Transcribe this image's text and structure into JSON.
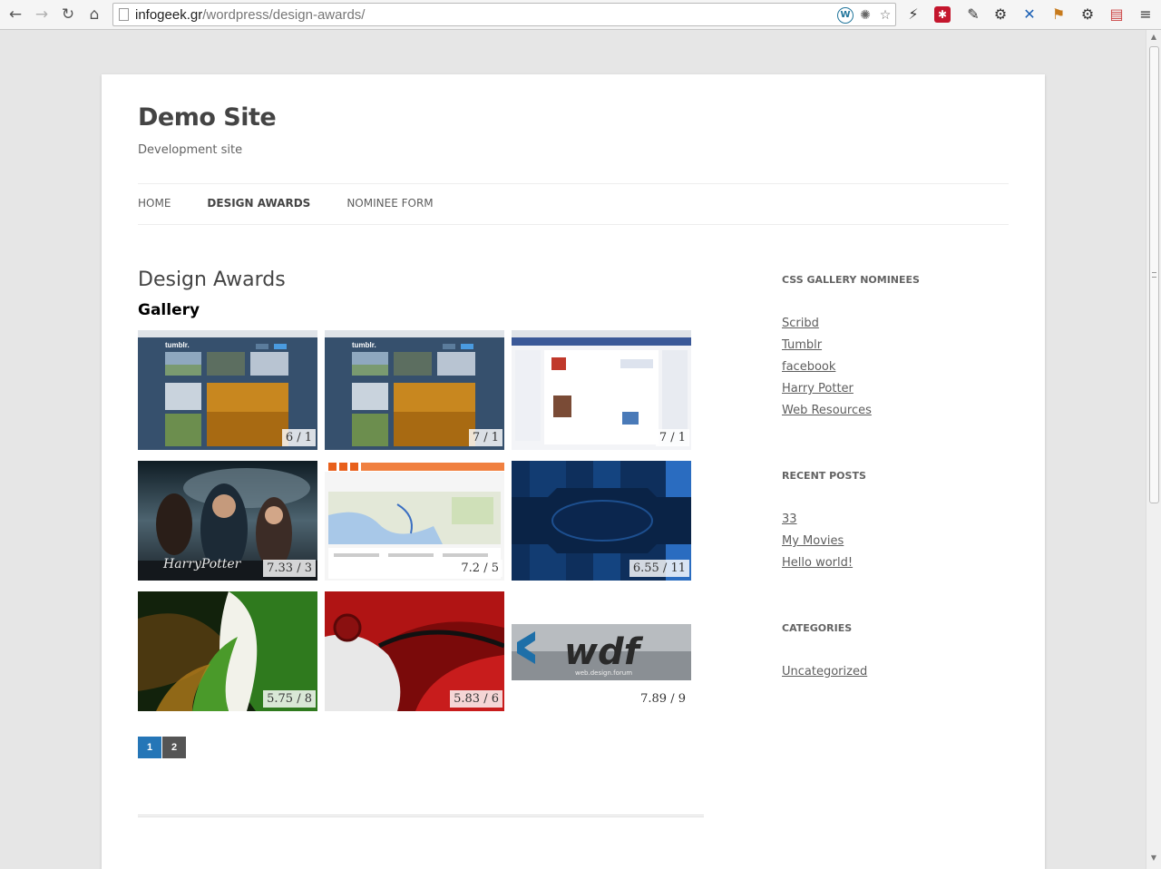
{
  "browser": {
    "url_host": "infogeek.gr",
    "url_path": "/wordpress/design-awards/",
    "back_icon": "arrow-left-icon",
    "forward_icon": "arrow-right-icon",
    "reload_icon": "reload-icon",
    "home_icon": "home-icon"
  },
  "site": {
    "title": "Demo Site",
    "description": "Development site"
  },
  "menu": {
    "items": [
      {
        "label": "HOME"
      },
      {
        "label": "DESIGN AWARDS"
      },
      {
        "label": "NOMINEE FORM"
      }
    ]
  },
  "main": {
    "title": "Design Awards",
    "gallery_heading": "Gallery",
    "gallery": [
      {
        "subject": "tumblr",
        "score": "6 / 1"
      },
      {
        "subject": "tumblr",
        "score": "7 / 1"
      },
      {
        "subject": "facebook",
        "score": "7 / 1"
      },
      {
        "subject": "harry-potter",
        "score": "7.33 / 3"
      },
      {
        "subject": "map",
        "score": "7.2 / 5"
      },
      {
        "subject": "blue-gear",
        "score": "6.55 / 11"
      },
      {
        "subject": "green-abstract",
        "score": "5.75 / 8"
      },
      {
        "subject": "red-abstract",
        "score": "5.83 / 6"
      },
      {
        "subject": "wdf-logo",
        "score": "7.89 / 9"
      }
    ],
    "pagination": [
      "1",
      "2"
    ]
  },
  "sidebar": {
    "widgets": [
      {
        "title": "CSS GALLERY NOMINEES",
        "links": [
          "Scribd",
          "Tumblr",
          "facebook",
          "Harry Potter",
          "Web Resources"
        ]
      },
      {
        "title": "RECENT POSTS",
        "links": [
          "33",
          "My Movies",
          "Hello world!"
        ]
      },
      {
        "title": "CATEGORIES",
        "links": [
          "Uncategorized"
        ]
      }
    ]
  },
  "colors": {
    "page_bg": "#e6e6e6",
    "accent": "#2576b7",
    "text": "#444444"
  }
}
